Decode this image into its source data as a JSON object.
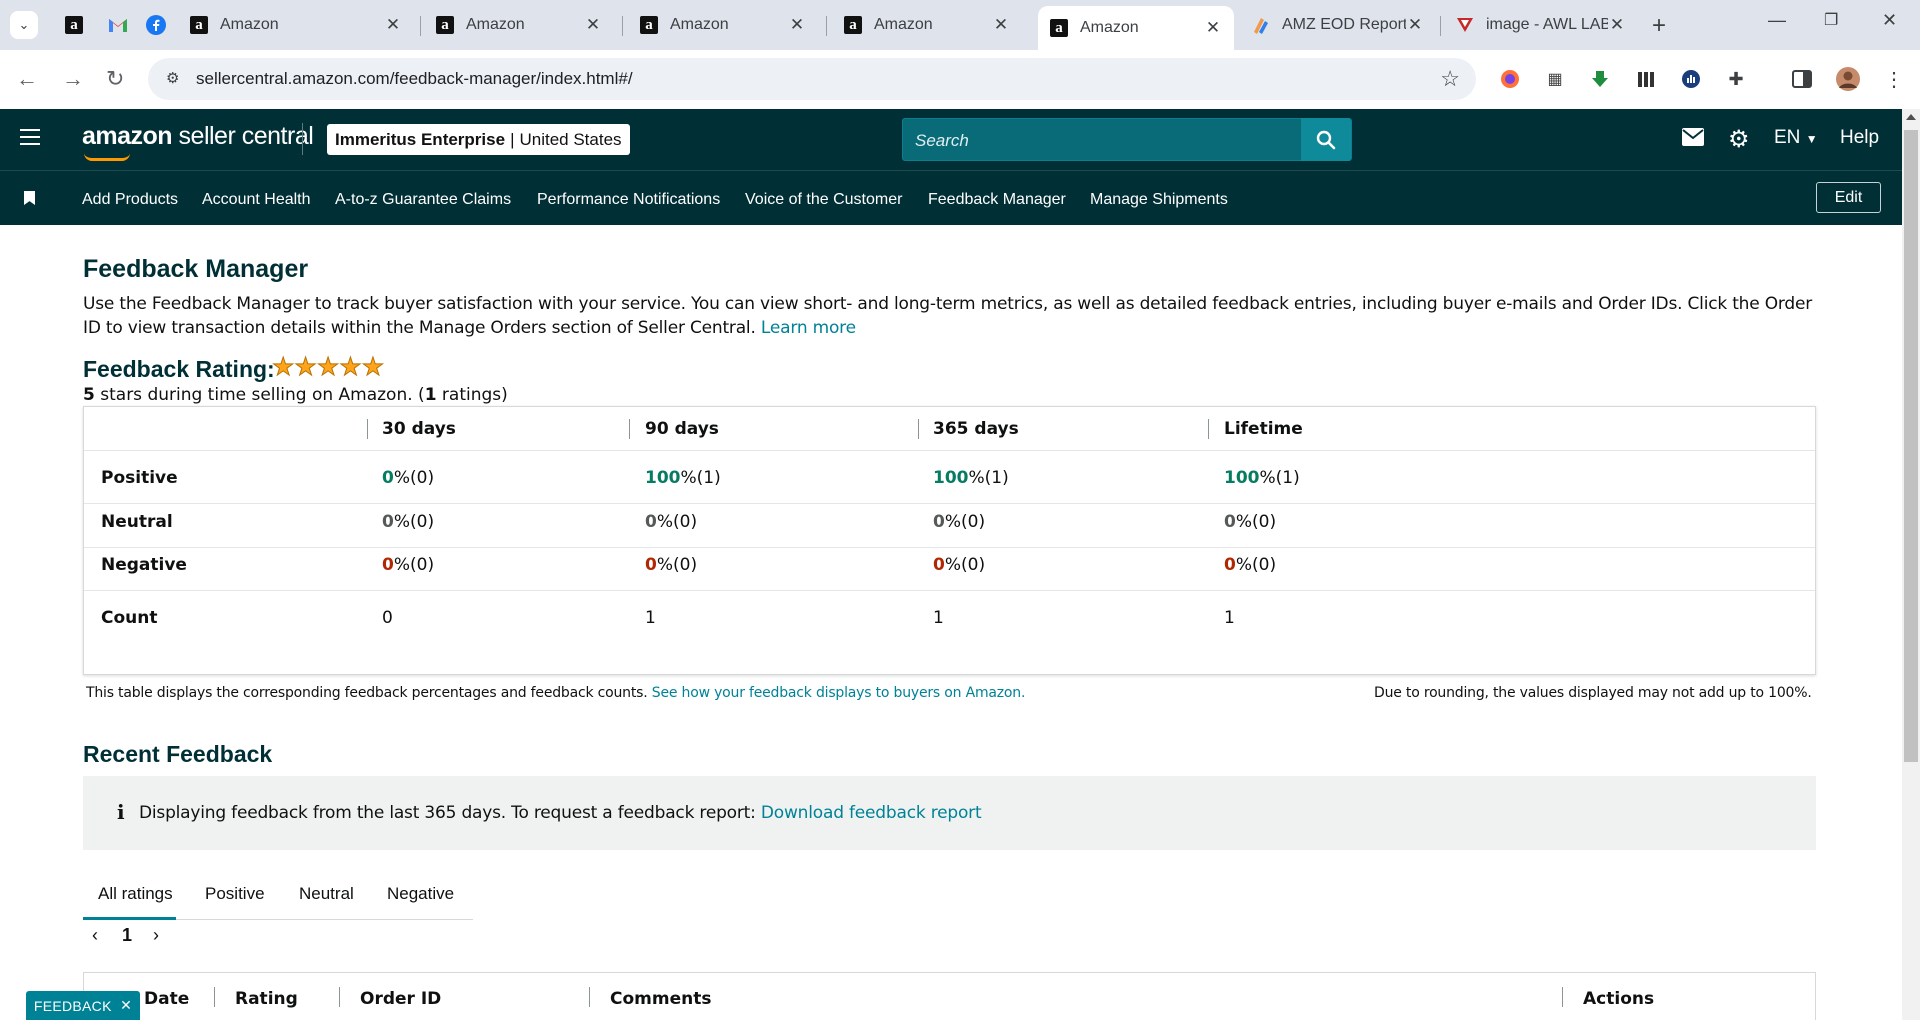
{
  "browser": {
    "tabs": [
      {
        "title": "Amazon",
        "active": false
      },
      {
        "title": "Amazon",
        "active": false
      },
      {
        "title": "Amazon",
        "active": false
      },
      {
        "title": "Amazon",
        "active": false
      },
      {
        "title": "Amazon",
        "active": true
      },
      {
        "title": "AMZ EOD Report",
        "active": false
      },
      {
        "title": "image - AWL LAB",
        "active": false
      }
    ],
    "url": "sellercentral.amazon.com/feedback-manager/index.html#/"
  },
  "header": {
    "logo_brand": "amazon",
    "logo_product": "seller central",
    "account_name": "Immeritus Enterprise",
    "account_separator": "|",
    "marketplace": "United States",
    "search_placeholder": "Search",
    "language": "EN",
    "help_label": "Help"
  },
  "nav": {
    "items": [
      "Add Products",
      "Account Health",
      "A-to-z Guarantee Claims",
      "Performance Notifications",
      "Voice of the Customer",
      "Feedback Manager",
      "Manage Shipments"
    ],
    "edit_label": "Edit"
  },
  "page": {
    "title": "Feedback Manager",
    "intro": "Use the Feedback Manager to track buyer satisfaction with your service. You can view short- and long-term metrics, as well as detailed feedback entries, including buyer e-mails and Order IDs. Click the Order ID to view transaction details within the Manage Orders section of Seller Central.",
    "learn_more": "Learn more",
    "rating_label": "Feedback Rating:",
    "star_count": 5,
    "rating_stars_value": "5",
    "rating_sub_mid": " stars during time selling on Amazon. (",
    "rating_count": "1",
    "rating_sub_end": " ratings)"
  },
  "feedback_table": {
    "columns": [
      "30 days",
      "90 days",
      "365 days",
      "Lifetime"
    ],
    "rows": [
      {
        "label": "Positive",
        "values": [
          {
            "num": "0",
            "pct": " %(0)"
          },
          {
            "num": "100",
            "pct": " %(1)"
          },
          {
            "num": "100",
            "pct": " %(1)"
          },
          {
            "num": "100",
            "pct": " %(1)"
          }
        ]
      },
      {
        "label": "Neutral",
        "values": [
          {
            "num": "0",
            "pct": " %(0)"
          },
          {
            "num": "0",
            "pct": " %(0)"
          },
          {
            "num": "0",
            "pct": " %(0)"
          },
          {
            "num": "0",
            "pct": " %(0)"
          }
        ]
      },
      {
        "label": "Negative",
        "values": [
          {
            "num": "0",
            "pct": " %(0)"
          },
          {
            "num": "0",
            "pct": " %(0)"
          },
          {
            "num": "0",
            "pct": " %(0)"
          },
          {
            "num": "0",
            "pct": " %(0)"
          }
        ]
      },
      {
        "label": "Count",
        "values": [
          {
            "num": "0"
          },
          {
            "num": "1"
          },
          {
            "num": "1"
          },
          {
            "num": "1"
          }
        ]
      }
    ],
    "note_left": "This table displays the corresponding feedback percentages and feedback counts.",
    "note_link": "See how your feedback displays to buyers on Amazon.",
    "note_right": "Due to rounding, the values displayed may not add up to 100%."
  },
  "recent": {
    "title": "Recent Feedback",
    "info_text": "Displaying feedback from the last 365 days. To request a feedback report:",
    "info_link": "Download feedback report",
    "tabs": [
      "All ratings",
      "Positive",
      "Neutral",
      "Negative"
    ],
    "current_page": "1",
    "columns": [
      "Date",
      "Rating",
      "Order ID",
      "Comments",
      "Actions"
    ]
  },
  "feedback_button": "FEEDBACK"
}
